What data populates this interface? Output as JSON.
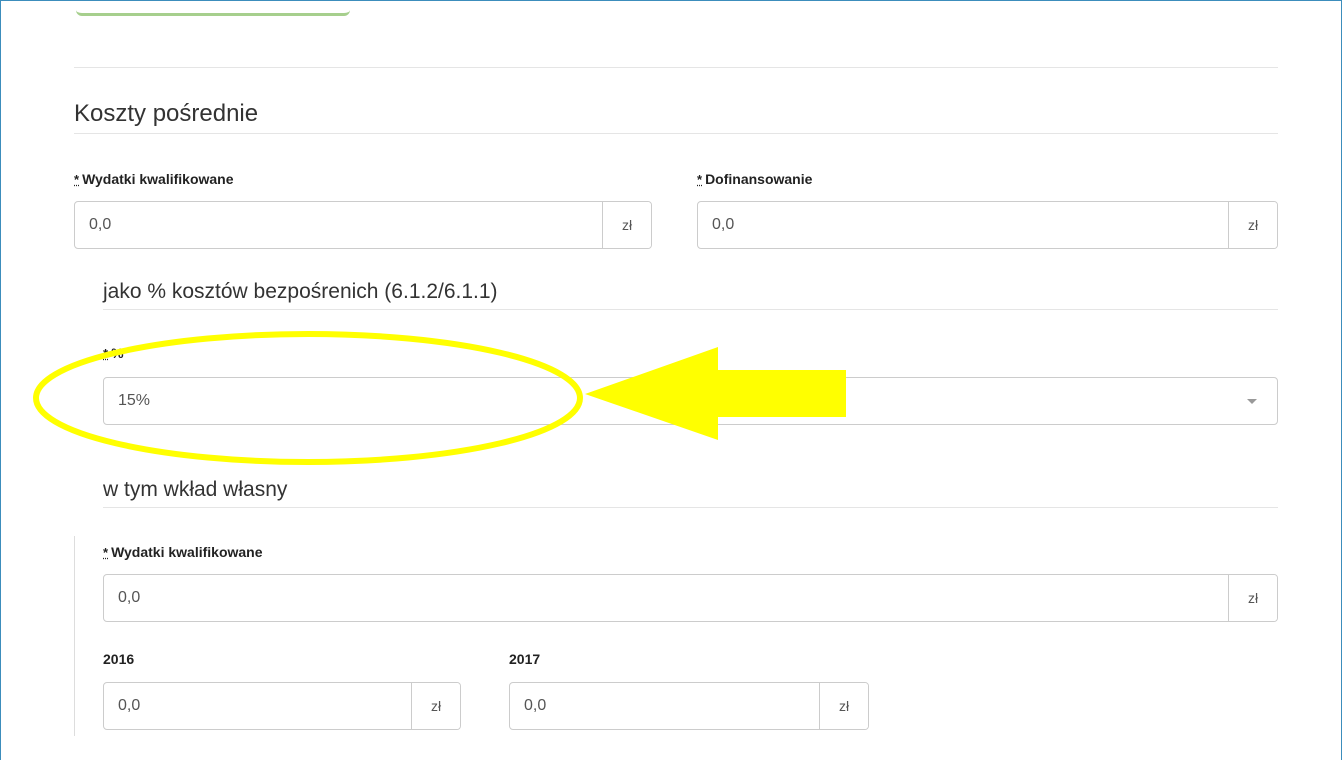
{
  "section": {
    "title": "Koszty pośrednie"
  },
  "required_marker": "*",
  "qualified_expenses": {
    "label": "Wydatki kwalifikowane",
    "value": "0,0",
    "unit": "zł"
  },
  "cofinancing": {
    "label": "Dofinansowanie",
    "value": "0,0",
    "unit": "zł"
  },
  "percent_section": {
    "title": "jako % kosztów bezpośrenich (6.1.2/6.1.1)"
  },
  "percent_field": {
    "label": "%",
    "selected": "15%"
  },
  "own_contribution": {
    "title": "w tym wkład własny"
  },
  "own_expenses": {
    "label": "Wydatki kwalifikowane",
    "value": "0,0",
    "unit": "zł"
  },
  "year_2016": {
    "label": "2016",
    "value": "0,0",
    "unit": "zł"
  },
  "year_2017": {
    "label": "2017",
    "value": "0,0",
    "unit": "zł"
  },
  "annotation": {
    "color": "#ffff00"
  }
}
